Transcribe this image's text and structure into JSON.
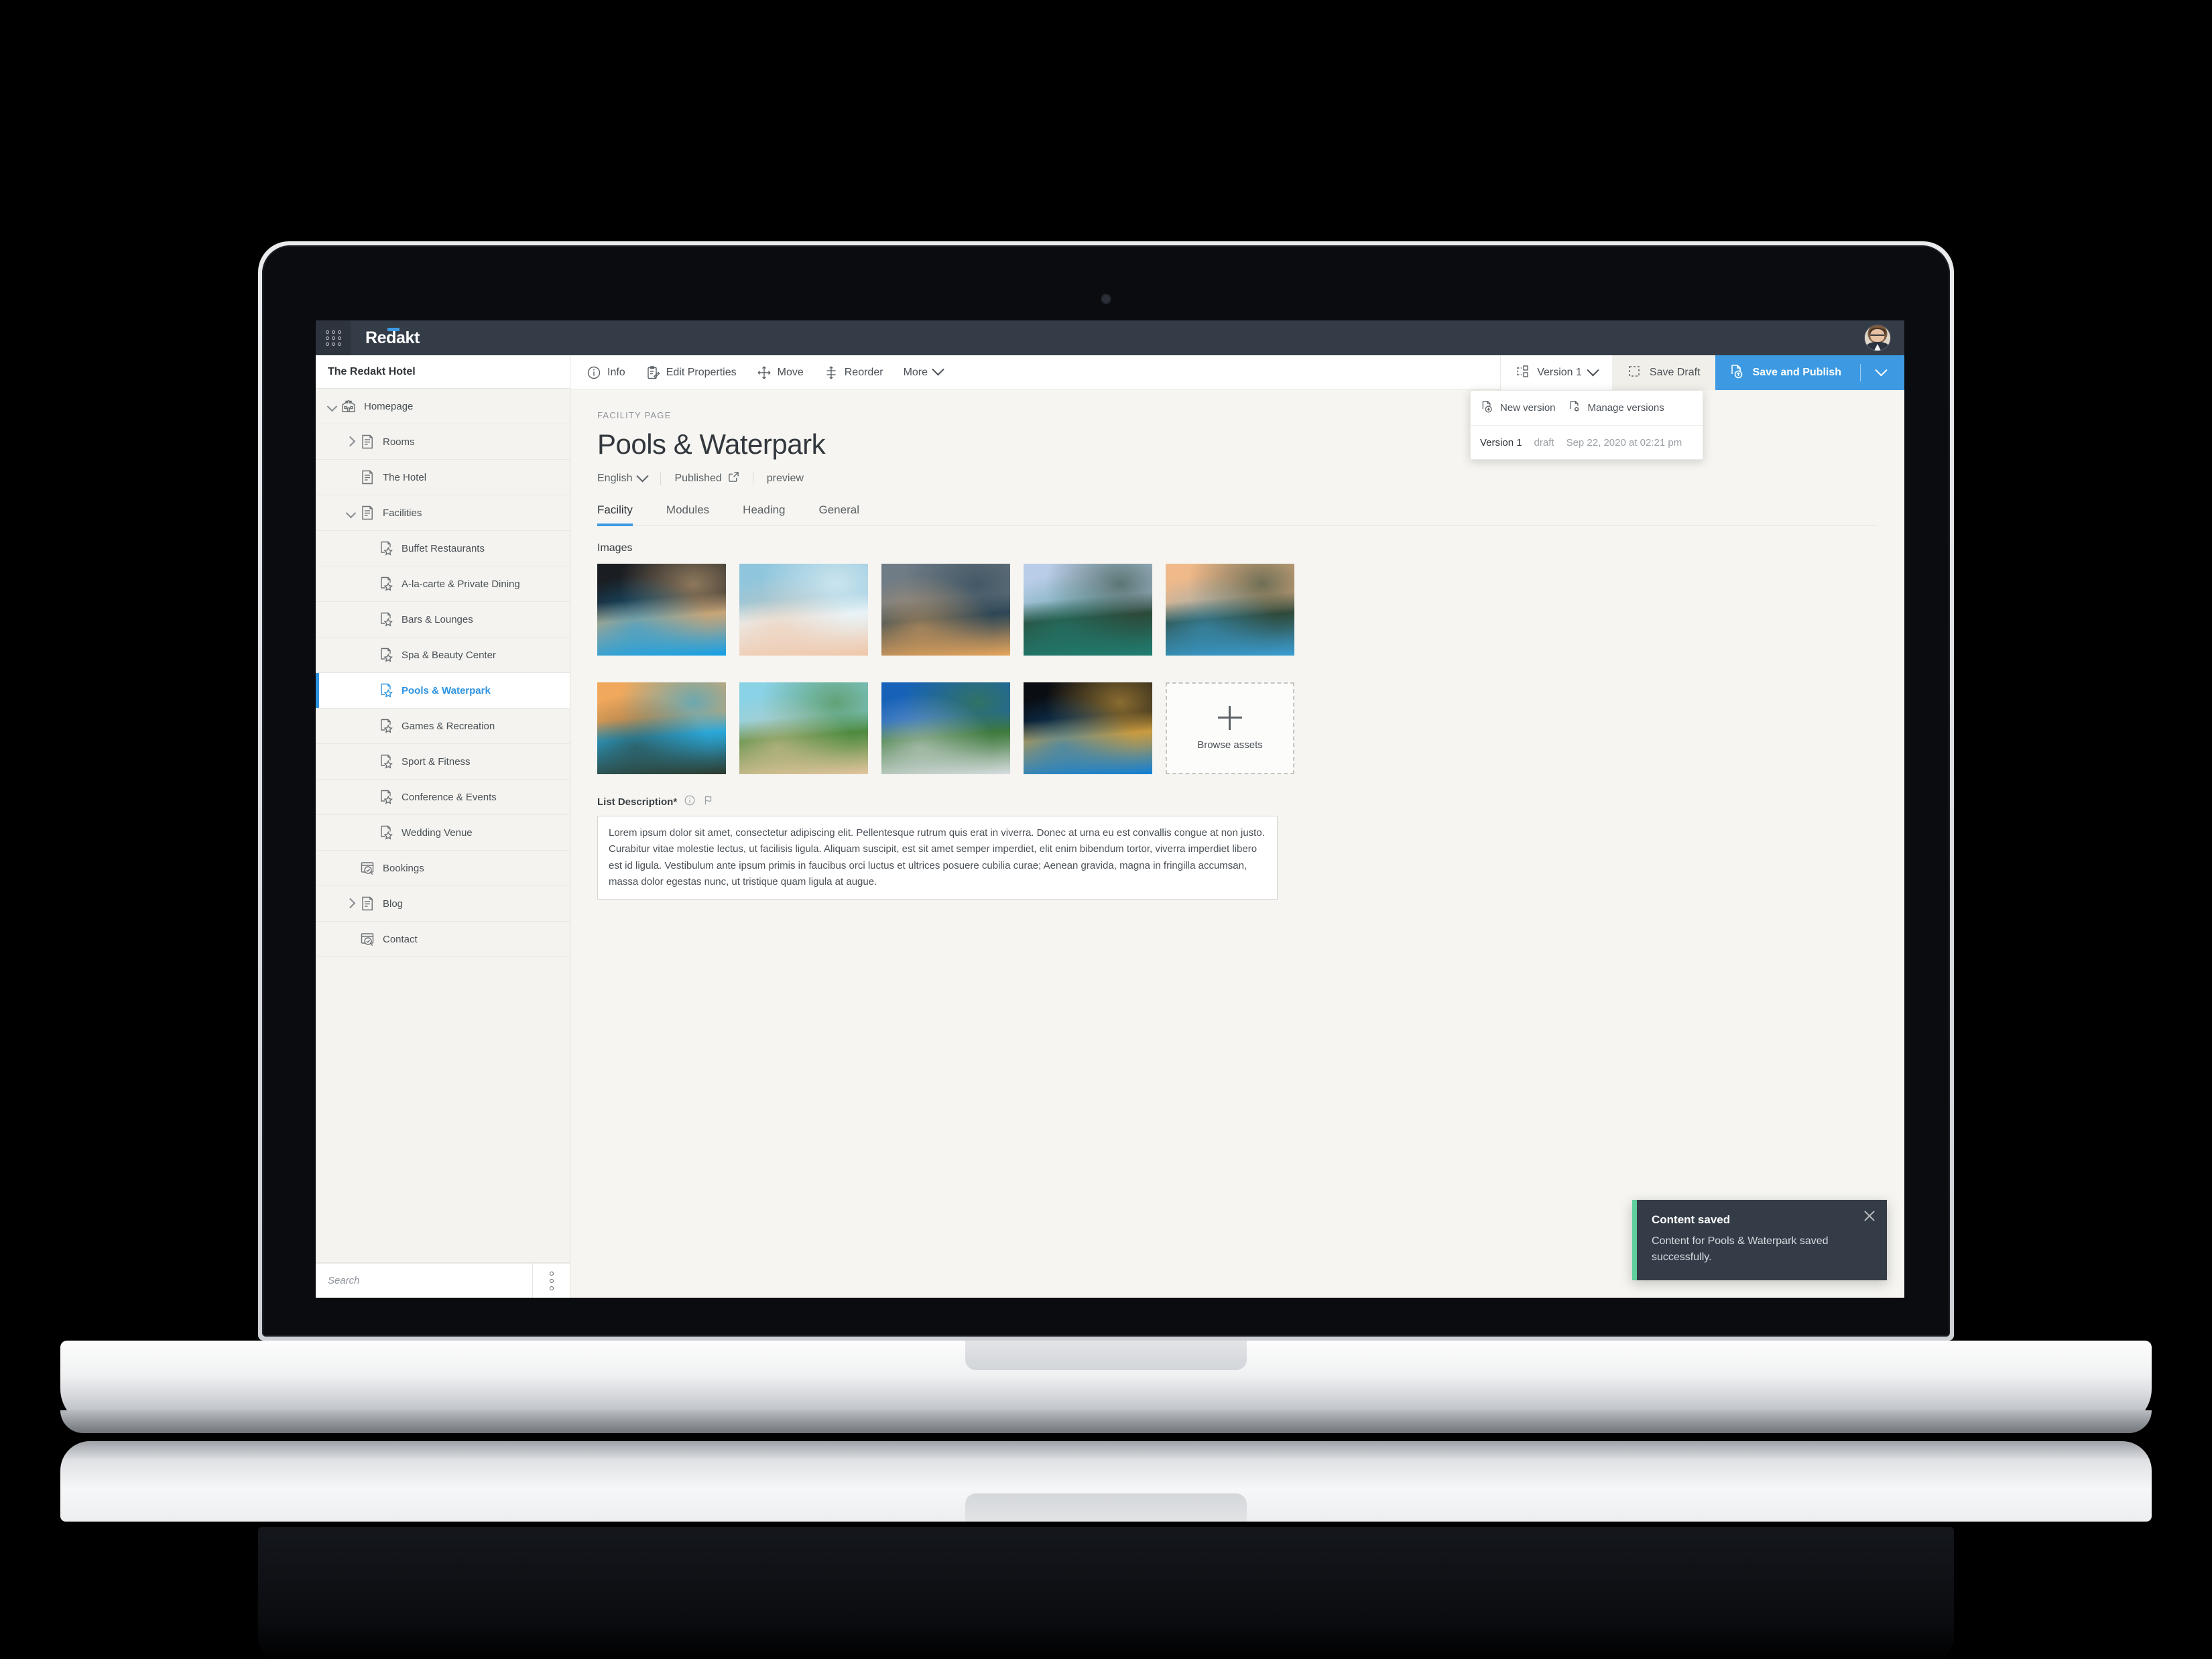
{
  "app": {
    "brand": "Redakt",
    "waffle_icon": "app-grid-icon",
    "avatar_icon": "user-avatar"
  },
  "sidebar": {
    "site_title": "The Redakt Hotel",
    "search": {
      "placeholder": "Search",
      "value": ""
    },
    "kebab_icon": "more-options-icon",
    "items": [
      {
        "label": "Homepage",
        "indent": 0,
        "chevron": "down",
        "icon": "home-page-icon",
        "selected": false
      },
      {
        "label": "Rooms",
        "indent": 1,
        "chevron": "right",
        "icon": "document-page-icon",
        "selected": false
      },
      {
        "label": "The Hotel",
        "indent": 1,
        "chevron": "none",
        "icon": "document-page-icon",
        "selected": false
      },
      {
        "label": "Facilities",
        "indent": 1,
        "chevron": "down",
        "icon": "document-page-icon",
        "selected": false
      },
      {
        "label": "Buffet Restaurants",
        "indent": 2,
        "chevron": "none",
        "icon": "facility-page-icon",
        "selected": false
      },
      {
        "label": "A-la-carte & Private Dining",
        "indent": 2,
        "chevron": "none",
        "icon": "facility-page-icon",
        "selected": false
      },
      {
        "label": "Bars & Lounges",
        "indent": 2,
        "chevron": "none",
        "icon": "facility-page-icon",
        "selected": false
      },
      {
        "label": "Spa & Beauty Center",
        "indent": 2,
        "chevron": "none",
        "icon": "facility-page-icon",
        "selected": false
      },
      {
        "label": "Pools & Waterpark",
        "indent": 2,
        "chevron": "none",
        "icon": "facility-page-icon",
        "selected": true
      },
      {
        "label": "Games & Recreation",
        "indent": 2,
        "chevron": "none",
        "icon": "facility-page-icon",
        "selected": false
      },
      {
        "label": "Sport & Fitness",
        "indent": 2,
        "chevron": "none",
        "icon": "facility-page-icon",
        "selected": false
      },
      {
        "label": "Conference & Events",
        "indent": 2,
        "chevron": "none",
        "icon": "facility-page-icon",
        "selected": false
      },
      {
        "label": "Wedding Venue",
        "indent": 2,
        "chevron": "none",
        "icon": "facility-page-icon",
        "selected": false
      },
      {
        "label": "Bookings",
        "indent": 1,
        "chevron": "none",
        "icon": "browser-search-icon",
        "selected": false
      },
      {
        "label": "Blog",
        "indent": 1,
        "chevron": "right",
        "icon": "document-page-icon",
        "selected": false
      },
      {
        "label": "Contact",
        "indent": 1,
        "chevron": "none",
        "icon": "browser-search-icon",
        "selected": false
      }
    ]
  },
  "toolbar": {
    "items": [
      {
        "label": "Info",
        "icon": "info-circle-icon"
      },
      {
        "label": "Edit Properties",
        "icon": "clipboard-edit-icon"
      },
      {
        "label": "Move",
        "icon": "move-arrows-icon"
      },
      {
        "label": "Reorder",
        "icon": "reorder-icon"
      },
      {
        "label": "More",
        "icon": "chevron-down-icon"
      }
    ],
    "version_label": "Version 1",
    "version_icon": "version-nodes-icon",
    "save_draft_label": "Save Draft",
    "save_draft_icon": "dashed-square-icon",
    "publish_label": "Save and Publish",
    "publish_icon": "publish-upload-icon",
    "publish_color": "#3d9ae2"
  },
  "version_dropdown": {
    "new_version": {
      "label": "New version",
      "icon": "document-plus-icon"
    },
    "manage_versions": {
      "label": "Manage versions",
      "icon": "document-gear-icon"
    },
    "row": {
      "name": "Version 1",
      "status": "draft",
      "date": "Sep 22, 2020 at 02:21 pm"
    }
  },
  "page": {
    "kicker": "FACILITY PAGE",
    "title": "Pools & Waterpark",
    "language": "English",
    "publish_state": "Published",
    "publish_state_icon": "external-link-icon",
    "preview_label": "preview",
    "tabs": [
      {
        "label": "Facility",
        "active": true
      },
      {
        "label": "Modules",
        "active": false
      },
      {
        "label": "Heading",
        "active": false
      },
      {
        "label": "General",
        "active": false
      }
    ],
    "images_label": "Images",
    "images": [
      {
        "alt": "hotel-at-night-with-lit-pool",
        "c1": "#1a1d22",
        "c2": "#12a0e8",
        "c3": "#c7a578"
      },
      {
        "alt": "child-splashing-in-pool",
        "c1": "#8fc6dd",
        "c2": "#f0c6a8",
        "c3": "#e9f3f6"
      },
      {
        "alt": "pool-at-sunset-with-palm-trees",
        "c1": "#6f7b85",
        "c2": "#e8a65c",
        "c3": "#2e4756"
      },
      {
        "alt": "green-water-slide-against-sky",
        "c1": "#b9cde8",
        "c2": "#1f7f72",
        "c3": "#2c4a3a"
      },
      {
        "alt": "resort-pool-sunset-sea-view",
        "c1": "#f0b98a",
        "c2": "#3a9fd4",
        "c3": "#2f4a3b"
      },
      {
        "alt": "palm-trees-sunrise-over-sea",
        "c1": "#f0a85c",
        "c2": "#2d3a2c",
        "c3": "#2aa7d8"
      },
      {
        "alt": "guests-in-waterpark-pool",
        "c1": "#8ad2e6",
        "c2": "#e4c59e",
        "c3": "#4e8b3f"
      },
      {
        "alt": "aerial-view-geometric-blue-pools",
        "c1": "#1762b8",
        "c2": "#d8dde0",
        "c3": "#3f7a3d"
      },
      {
        "alt": "illuminated-pool-aerial-at-night",
        "c1": "#0a0d12",
        "c2": "#0e7fd6",
        "c3": "#c99b3f"
      }
    ],
    "browse_assets_label": "Browse assets",
    "list_description": {
      "label": "List Description*",
      "info_icon": "info-circle-icon",
      "flag_icon": "flag-icon",
      "value": "Lorem ipsum dolor sit amet, consectetur adipiscing elit. Pellentesque rutrum quis erat in viverra. Donec at urna eu est convallis congue at non justo. Curabitur vitae molestie lectus, ut facilisis ligula. Aliquam suscipit, est sit amet semper imperdiet, elit enim bibendum tortor, viverra imperdiet libero est id ligula. Vestibulum ante ipsum primis in faucibus orci luctus et ultrices posuere cubilia curae; Aenean gravida, magna in fringilla accumsan, massa dolor egestas nunc, ut tristique quam ligula at augue."
    }
  },
  "toast": {
    "title": "Content saved",
    "message": "Content for Pools & Waterpark saved successfully.",
    "accent_color": "#5fcf9c",
    "close_icon": "close-icon"
  }
}
